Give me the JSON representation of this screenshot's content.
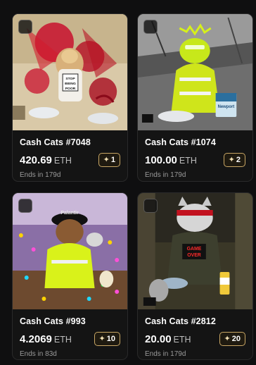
{
  "cards": [
    {
      "title": "Cash Cats #7048",
      "price": "420.69",
      "currency": "ETH",
      "ends": "Ends in 179d",
      "badge_count": "1",
      "art_text": "STOP BEING POOR"
    },
    {
      "title": "Cash Cats #1074",
      "price": "100.00",
      "currency": "ETH",
      "ends": "Ends in 179d",
      "badge_count": "2",
      "art_text": "Newport"
    },
    {
      "title": "Cash Cats #993",
      "price": "4.2069",
      "currency": "ETH",
      "ends": "Ends in 83d",
      "badge_count": "10",
      "art_text": "Palantir"
    },
    {
      "title": "Cash Cats #2812",
      "price": "20.00",
      "currency": "ETH",
      "ends": "Ends in 179d",
      "badge_count": "20",
      "art_text": "GAME OVER"
    }
  ],
  "icons": {
    "badge": "sparkle-icon",
    "select": "checkbox"
  },
  "colors": {
    "background": "#0f0f10",
    "card": "#141414",
    "badge_border": "#c9a765"
  }
}
